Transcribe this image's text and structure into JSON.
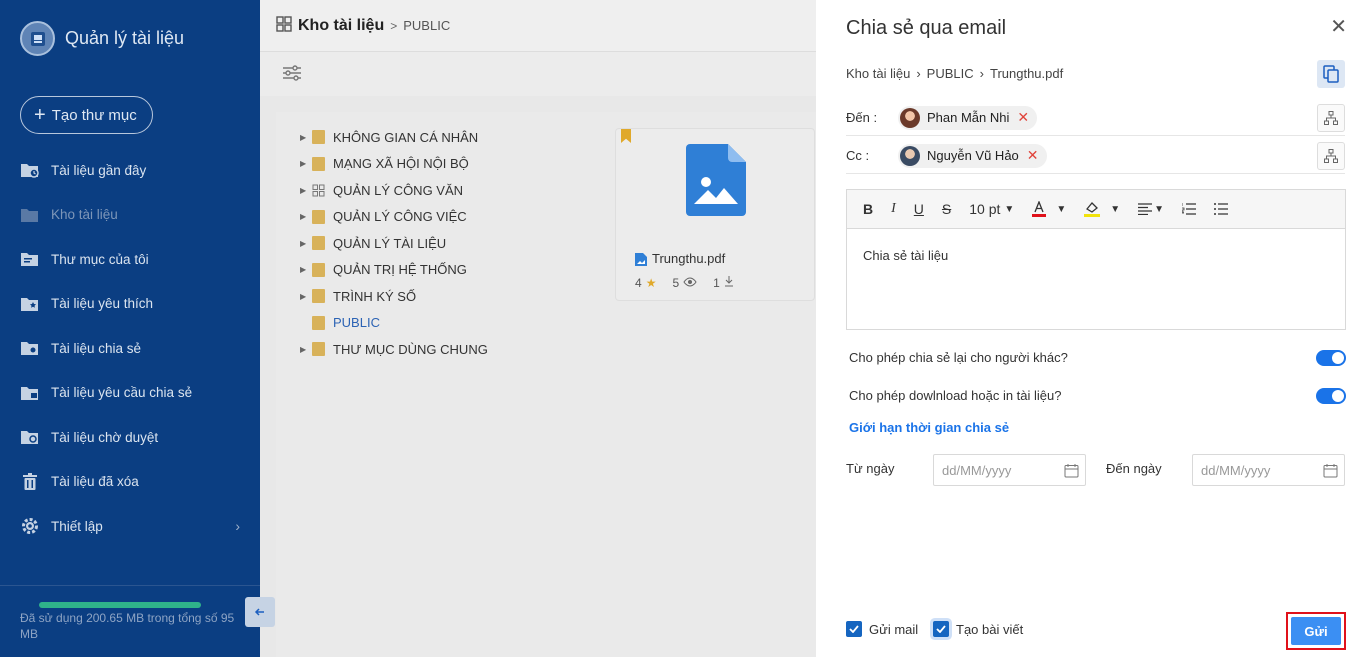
{
  "sidebar": {
    "app_title": "Quản lý tài liệu",
    "new_folder": "Tạo thư mục",
    "items": [
      {
        "label": "Tài liệu gần đây",
        "icon": "recent-docs-icon"
      },
      {
        "label": "Kho tài liệu",
        "icon": "repository-icon",
        "active": true
      },
      {
        "label": "Thư mục của tôi",
        "icon": "my-folder-icon"
      },
      {
        "label": "Tài liệu yêu thích",
        "icon": "favorite-docs-icon"
      },
      {
        "label": "Tài liệu chia sẻ",
        "icon": "shared-docs-icon"
      },
      {
        "label": "Tài liệu yêu cầu chia sẻ",
        "icon": "share-request-icon"
      },
      {
        "label": "Tài liệu chờ duyệt",
        "icon": "pending-approval-icon"
      },
      {
        "label": "Tài liệu đã xóa",
        "icon": "trash-icon"
      },
      {
        "label": "Thiết lập",
        "icon": "gear-icon"
      }
    ],
    "storage_text": "Đã sử dụng 200.65 MB trong tổng số 95 MB",
    "storage_fraction": 1.0
  },
  "main": {
    "breadcrumb_root": "Kho tài liệu",
    "breadcrumb_current": "PUBLIC",
    "tree": [
      {
        "label": "KHÔNG GIAN CÁ NHÂN",
        "caret": true,
        "icon": "folder"
      },
      {
        "label": "MẠNG XÃ HỘI NỘI BỘ",
        "caret": true,
        "icon": "folder"
      },
      {
        "label": "QUẢN LÝ CÔNG VĂN",
        "caret": true,
        "icon": "grid"
      },
      {
        "label": "QUẢN LÝ CÔNG VIỆC",
        "caret": true,
        "icon": "folder"
      },
      {
        "label": "QUẢN LÝ TÀI LIỆU",
        "caret": true,
        "icon": "folder"
      },
      {
        "label": "QUẢN TRỊ HỆ THỐNG",
        "caret": true,
        "icon": "folder"
      },
      {
        "label": "TRÌNH KÝ SỐ",
        "caret": true,
        "icon": "folder"
      },
      {
        "label": "PUBLIC",
        "caret": false,
        "icon": "folder",
        "selected": true
      },
      {
        "label": "THƯ MỤC DÙNG CHUNG",
        "caret": true,
        "icon": "folder"
      }
    ],
    "file": {
      "name": "Trungthu.pdf",
      "rating": "4",
      "views": "5",
      "downloads": "1"
    }
  },
  "share": {
    "title": "Chia sẻ qua email",
    "path": [
      "Kho tài liệu",
      "PUBLIC",
      "Trungthu.pdf"
    ],
    "to_label": "Đến :",
    "to_chip": "Phan Mẫn Nhi",
    "cc_label": "Cc :",
    "cc_chip": "Nguyễn Vũ Hảo",
    "font_size": "10 pt",
    "body_text": "Chia sẻ tài liệu",
    "allow_reshare": "Cho phép chia sẻ lại cho người khác?",
    "allow_download": "Cho phép dowlnload hoặc in tài liệu?",
    "limit_link": "Giới hạn thời gian chia sẻ",
    "from_date_label": "Từ ngày",
    "to_date_label": "Đến ngày",
    "date_placeholder": "dd/MM/yyyy",
    "send_mail": "Gửi mail",
    "create_post": "Tạo bài viết",
    "send_button": "Gửi",
    "colors": {
      "accent": "#1a73e8",
      "sidebar": "#0b3e82",
      "highlight_border": "#e0111a"
    }
  }
}
